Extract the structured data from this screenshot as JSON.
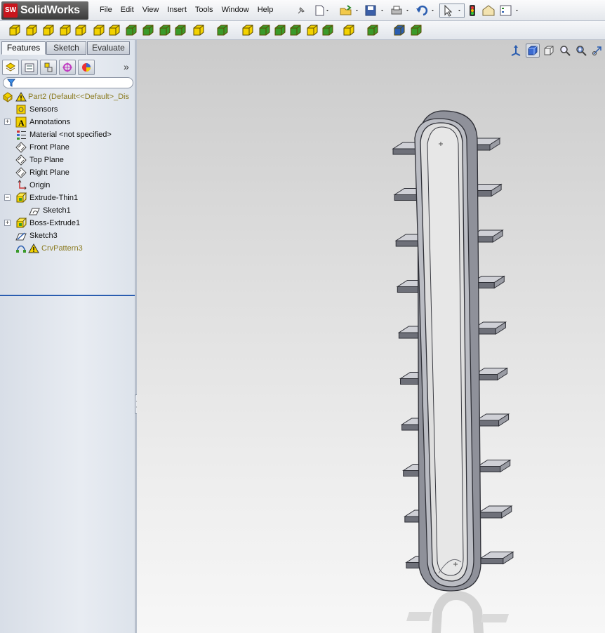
{
  "app": {
    "logo_badge": "SW",
    "logo_text_bold": "Solid",
    "logo_text": "Works"
  },
  "menu": [
    "File",
    "Edit",
    "View",
    "Insert",
    "Tools",
    "Window",
    "Help"
  ],
  "tabs": {
    "features": "Features",
    "sketch": "Sketch",
    "evaluate": "Evaluate",
    "active": "Features"
  },
  "manager_tabs": [
    "featuremanager-icon",
    "propertymanager-icon",
    "configurationmanager-icon",
    "dimxpert-icon",
    "display-manager-icon"
  ],
  "tree": {
    "part": "Part2  (Default<<Default>_Dis",
    "sensors": "Sensors",
    "annotations": "Annotations",
    "material": "Material <not specified>",
    "front_plane": "Front Plane",
    "top_plane": "Top Plane",
    "right_plane": "Right Plane",
    "origin": "Origin",
    "extrude_thin": "Extrude-Thin1",
    "sketch1": "Sketch1",
    "boss_extrude": "Boss-Extrude1",
    "sketch3": "Sketch3",
    "crv_pattern": "CrvPattern3"
  },
  "colors": {
    "accent": "#2a5db0",
    "warning_text": "#8a7a1f",
    "feature_yellow": "#f3d200",
    "feature_green": "#3a9a2a"
  },
  "view_tools": [
    "view-orientation-icon",
    "display-style-icon",
    "section-view-icon",
    "zoom-to-fit-icon",
    "zoom-area-icon",
    "previous-view-icon"
  ]
}
